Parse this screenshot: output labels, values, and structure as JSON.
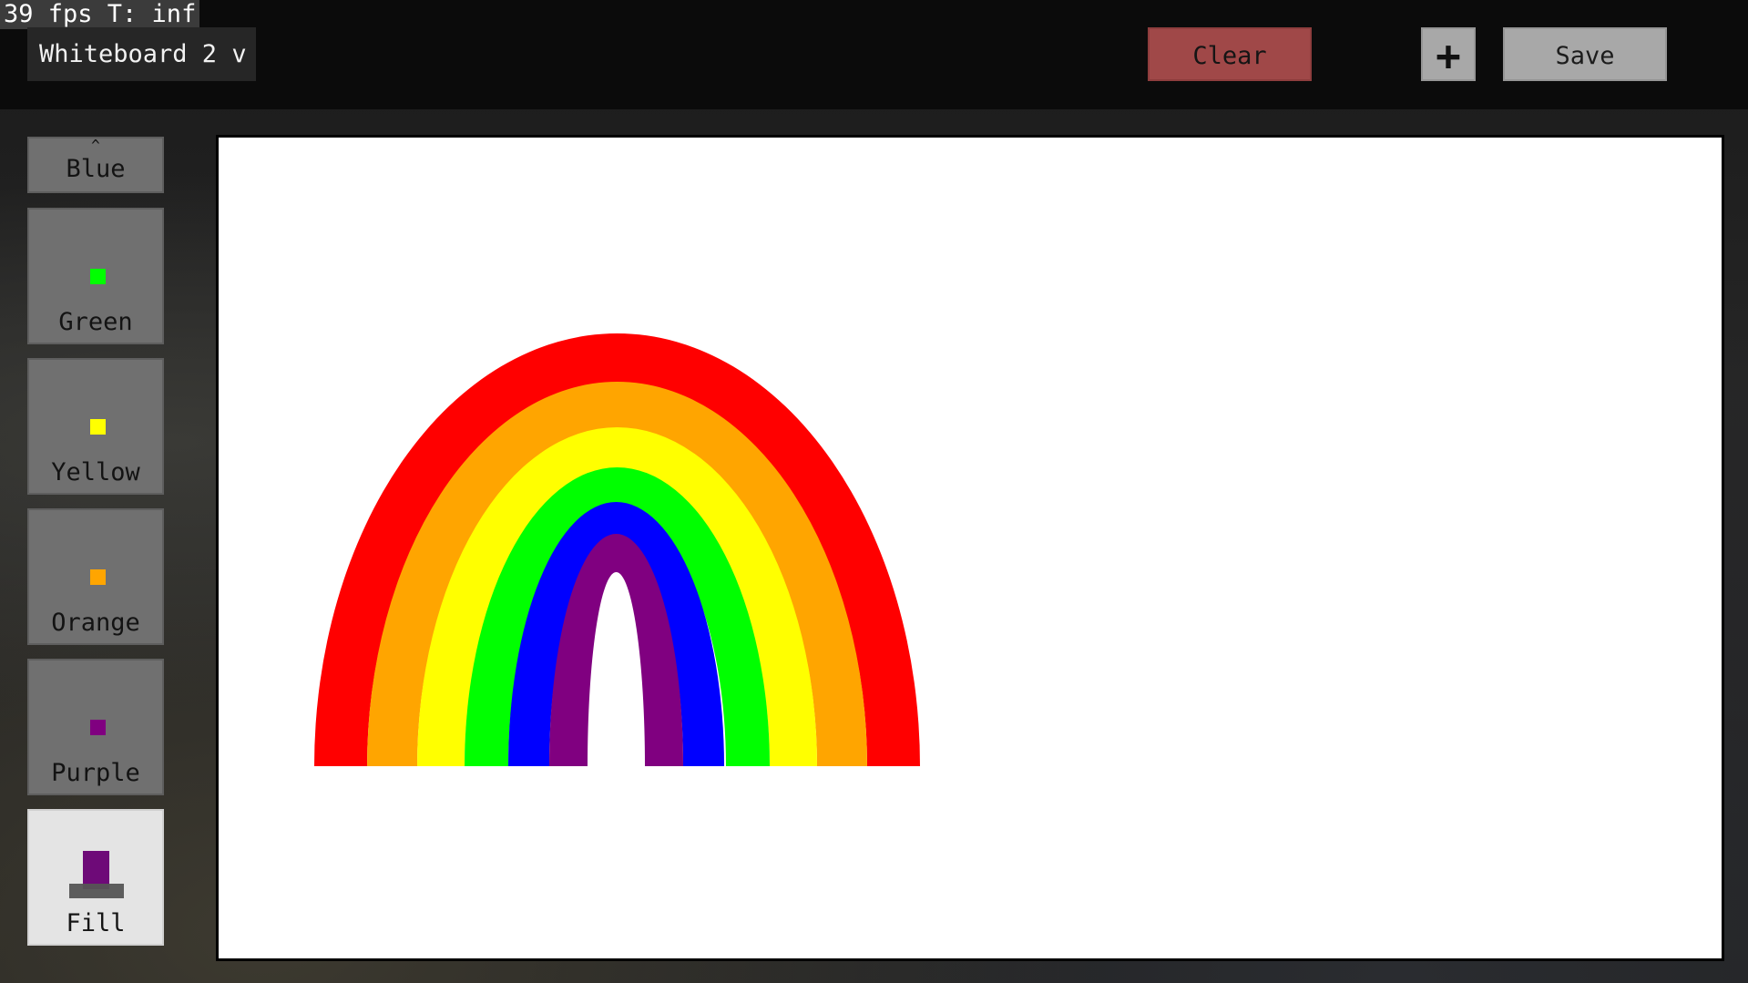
{
  "hud": {
    "fps_text": "39 fps T: inf"
  },
  "toolbar": {
    "whiteboard_select": "Whiteboard 2 v",
    "clear_label": "Clear",
    "add_label": "+",
    "save_label": "Save"
  },
  "palette": {
    "scroll_up_glyph": "^",
    "items": [
      {
        "label": "Blue"
      },
      {
        "label": "Green",
        "color": "#00ff00"
      },
      {
        "label": "Yellow",
        "color": "#ffff00"
      },
      {
        "label": "Orange",
        "color": "#ffa500"
      },
      {
        "label": "Purple",
        "color": "#800080"
      },
      {
        "label": "Fill",
        "color": "#800080",
        "selected": true,
        "icon": "fill-bucket-icon"
      }
    ]
  },
  "drawing": {
    "content": "rainbow",
    "band_colors": [
      "#ff0000",
      "#ffa500",
      "#ffff00",
      "#00ff00",
      "#0000ff",
      "#800080"
    ]
  }
}
